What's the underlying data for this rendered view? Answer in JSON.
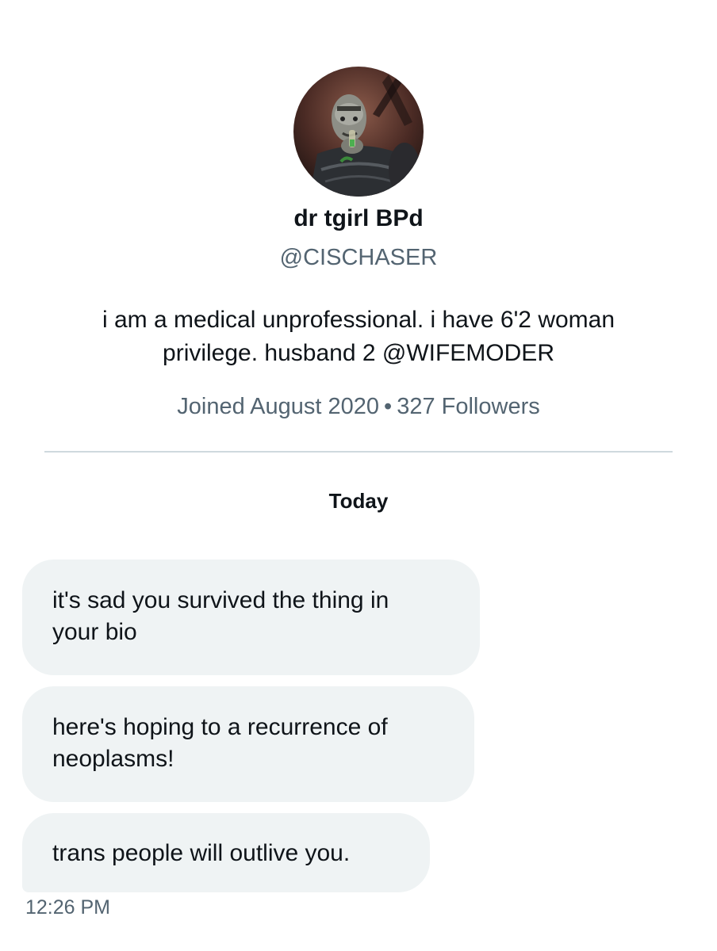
{
  "profile": {
    "display_name": "dr tgirl BPd",
    "handle": "@CISCHASER",
    "bio_line1": "i am a medical unprofessional. i have 6'2 woman",
    "bio_line2_prefix": "privilege. husband 2 ",
    "bio_mention": "@WIFEMODER",
    "joined": "Joined August 2020",
    "separator": "•",
    "followers": "327 Followers",
    "avatar_icon": "profile-photo"
  },
  "conversation": {
    "date_label": "Today",
    "messages": [
      {
        "line1": "it's sad you survived the thing in",
        "line2": "your bio"
      },
      {
        "line1": "here's hoping to a recurrence of",
        "line2": "neoplasms!"
      },
      {
        "line1": "trans people will outlive you."
      }
    ],
    "timestamp": "12:26 PM"
  },
  "colors": {
    "text": "#0f1419",
    "secondary": "#536471",
    "bubble": "#eff3f4",
    "divider": "#cfd9de"
  }
}
